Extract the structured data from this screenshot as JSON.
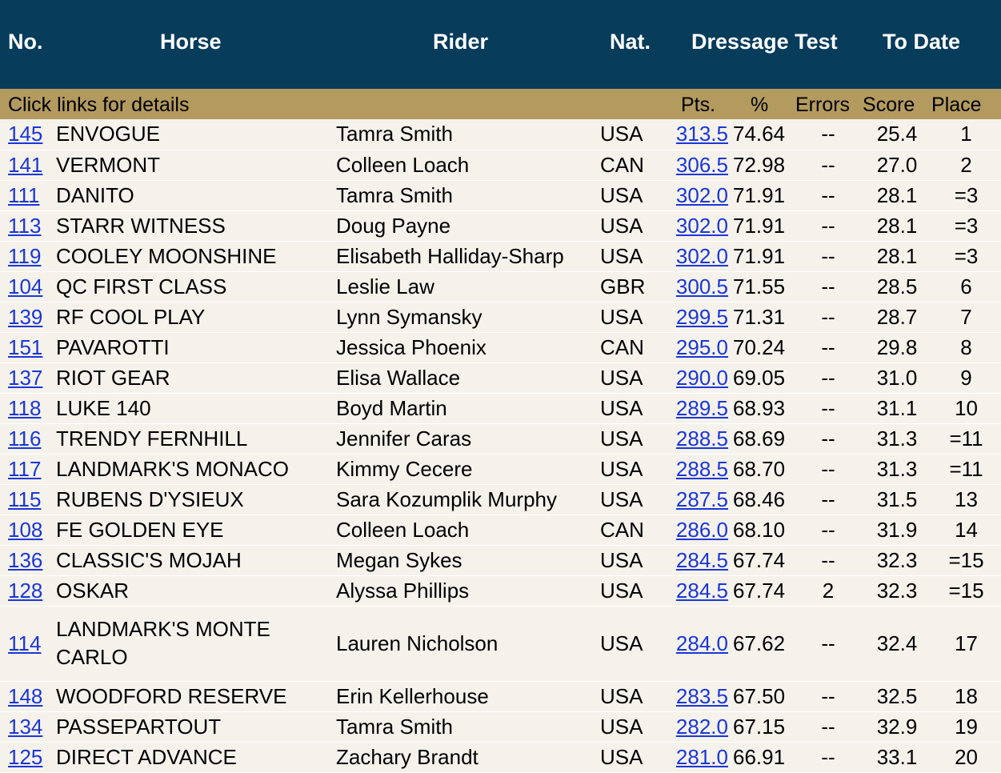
{
  "header": {
    "no": "No.",
    "horse": "Horse",
    "rider": "Rider",
    "nat": "Nat.",
    "dressage_test": "Dressage Test",
    "to_date": "To Date"
  },
  "subheader": {
    "hint": "Click links for details",
    "pts": "Pts.",
    "pct": "%",
    "errors": "Errors",
    "score": "Score",
    "place": "Place"
  },
  "colors": {
    "header_bg": "#073c5b",
    "subheader_bg": "#b39a5f",
    "row_bg": "#f5f2eb",
    "link": "#1a36d8"
  },
  "rows": [
    {
      "no": "145",
      "horse": "ENVOGUE",
      "rider": "Tamra Smith",
      "nat": "USA",
      "pts": "313.5",
      "pct": "74.64",
      "errors": "--",
      "score": "25.4",
      "place": "1"
    },
    {
      "no": "141",
      "horse": "VERMONT",
      "rider": "Colleen Loach",
      "nat": "CAN",
      "pts": "306.5",
      "pct": "72.98",
      "errors": "--",
      "score": "27.0",
      "place": "2"
    },
    {
      "no": "111",
      "horse": "DANITO",
      "rider": "Tamra Smith",
      "nat": "USA",
      "pts": "302.0",
      "pct": "71.91",
      "errors": "--",
      "score": "28.1",
      "place": "=3"
    },
    {
      "no": "113",
      "horse": "STARR WITNESS",
      "rider": "Doug Payne",
      "nat": "USA",
      "pts": "302.0",
      "pct": "71.91",
      "errors": "--",
      "score": "28.1",
      "place": "=3"
    },
    {
      "no": "119",
      "horse": "COOLEY MOONSHINE",
      "rider": "Elisabeth Halliday-Sharp",
      "nat": "USA",
      "pts": "302.0",
      "pct": "71.91",
      "errors": "--",
      "score": "28.1",
      "place": "=3"
    },
    {
      "no": "104",
      "horse": "QC FIRST CLASS",
      "rider": "Leslie Law",
      "nat": "GBR",
      "pts": "300.5",
      "pct": "71.55",
      "errors": "--",
      "score": "28.5",
      "place": "6"
    },
    {
      "no": "139",
      "horse": "RF COOL PLAY",
      "rider": "Lynn Symansky",
      "nat": "USA",
      "pts": "299.5",
      "pct": "71.31",
      "errors": "--",
      "score": "28.7",
      "place": "7"
    },
    {
      "no": "151",
      "horse": "PAVAROTTI",
      "rider": "Jessica Phoenix",
      "nat": "CAN",
      "pts": "295.0",
      "pct": "70.24",
      "errors": "--",
      "score": "29.8",
      "place": "8"
    },
    {
      "no": "137",
      "horse": "RIOT GEAR",
      "rider": "Elisa Wallace",
      "nat": "USA",
      "pts": "290.0",
      "pct": "69.05",
      "errors": "--",
      "score": "31.0",
      "place": "9"
    },
    {
      "no": "118",
      "horse": "LUKE 140",
      "rider": "Boyd Martin",
      "nat": "USA",
      "pts": "289.5",
      "pct": "68.93",
      "errors": "--",
      "score": "31.1",
      "place": "10"
    },
    {
      "no": "116",
      "horse": "TRENDY FERNHILL",
      "rider": "Jennifer Caras",
      "nat": "USA",
      "pts": "288.5",
      "pct": "68.69",
      "errors": "--",
      "score": "31.3",
      "place": "=11"
    },
    {
      "no": "117",
      "horse": "LANDMARK'S MONACO",
      "rider": "Kimmy Cecere",
      "nat": "USA",
      "pts": "288.5",
      "pct": "68.70",
      "errors": "--",
      "score": "31.3",
      "place": "=11"
    },
    {
      "no": "115",
      "horse": "RUBENS D'YSIEUX",
      "rider": "Sara Kozumplik Murphy",
      "nat": "USA",
      "pts": "287.5",
      "pct": "68.46",
      "errors": "--",
      "score": "31.5",
      "place": "13"
    },
    {
      "no": "108",
      "horse": "FE GOLDEN EYE",
      "rider": "Colleen Loach",
      "nat": "CAN",
      "pts": "286.0",
      "pct": "68.10",
      "errors": "--",
      "score": "31.9",
      "place": "14"
    },
    {
      "no": "136",
      "horse": "CLASSIC'S MOJAH",
      "rider": "Megan Sykes",
      "nat": "USA",
      "pts": "284.5",
      "pct": "67.74",
      "errors": "--",
      "score": "32.3",
      "place": "=15"
    },
    {
      "no": "128",
      "horse": "OSKAR",
      "rider": "Alyssa Phillips",
      "nat": "USA",
      "pts": "284.5",
      "pct": "67.74",
      "errors": "2",
      "score": "32.3",
      "place": "=15"
    },
    {
      "no": "114",
      "horse": "LANDMARK'S MONTE CARLO",
      "rider": "Lauren Nicholson",
      "nat": "USA",
      "pts": "284.0",
      "pct": "67.62",
      "errors": "--",
      "score": "32.4",
      "place": "17"
    },
    {
      "no": "148",
      "horse": "WOODFORD RESERVE",
      "rider": "Erin Kellerhouse",
      "nat": "USA",
      "pts": "283.5",
      "pct": "67.50",
      "errors": "--",
      "score": "32.5",
      "place": "18"
    },
    {
      "no": "134",
      "horse": "PASSEPARTOUT",
      "rider": "Tamra Smith",
      "nat": "USA",
      "pts": "282.0",
      "pct": "67.15",
      "errors": "--",
      "score": "32.9",
      "place": "19"
    },
    {
      "no": "125",
      "horse": "DIRECT ADVANCE",
      "rider": "Zachary Brandt",
      "nat": "USA",
      "pts": "281.0",
      "pct": "66.91",
      "errors": "--",
      "score": "33.1",
      "place": "20"
    }
  ]
}
